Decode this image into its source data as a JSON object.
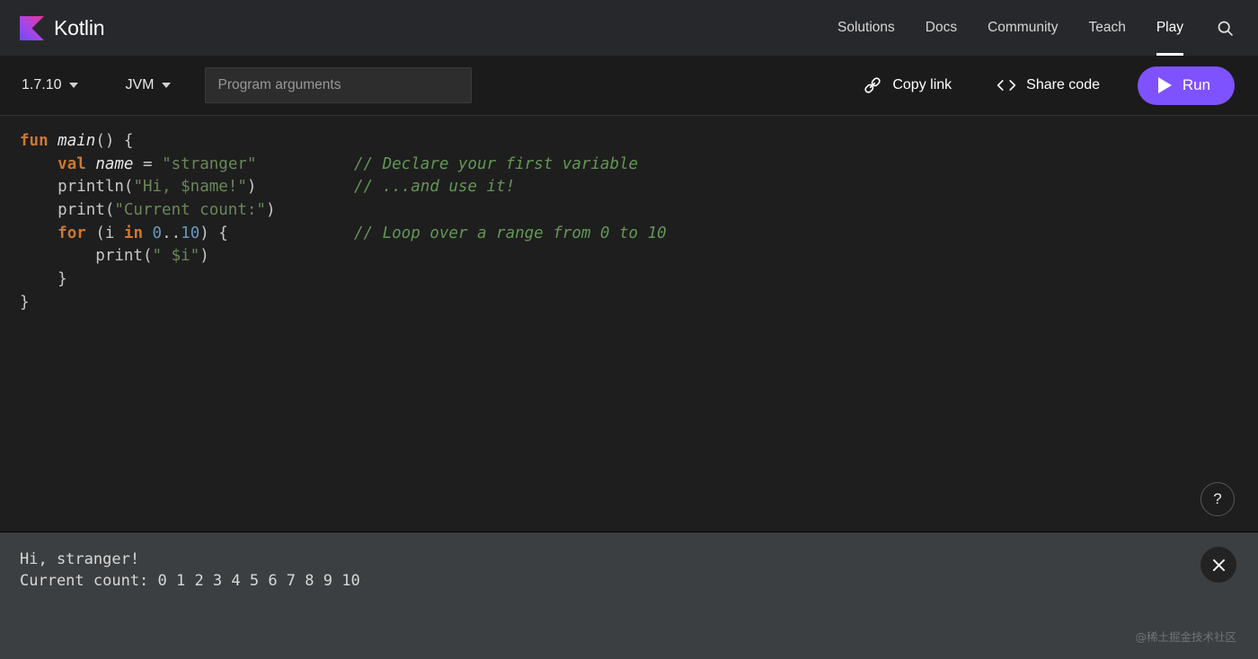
{
  "header": {
    "brand": {
      "name": "Kotlin",
      "logo_icon": "kotlin-logo-icon"
    },
    "nav": [
      {
        "label": "Solutions",
        "active": false
      },
      {
        "label": "Docs",
        "active": false
      },
      {
        "label": "Community",
        "active": false
      },
      {
        "label": "Teach",
        "active": false
      },
      {
        "label": "Play",
        "active": true
      }
    ],
    "search_icon": "search-icon"
  },
  "toolbar": {
    "version": "1.7.10",
    "platform": "JVM",
    "args_placeholder": "Program arguments",
    "args_value": "",
    "copy_link_label": "Copy link",
    "copy_link_icon": "link-icon",
    "share_code_label": "Share code",
    "share_code_icon": "code-brackets-icon",
    "run_label": "Run",
    "run_icon": "play-icon",
    "run_color": "#7f52ff"
  },
  "editor": {
    "language": "kotlin",
    "lines": [
      {
        "tokens": [
          {
            "t": "fun ",
            "c": "kw"
          },
          {
            "t": "main",
            "c": "fnname"
          },
          {
            "t": "() {",
            "c": "plain"
          }
        ],
        "comment": ""
      },
      {
        "tokens": [
          {
            "t": "    ",
            "c": "plain"
          },
          {
            "t": "val ",
            "c": "kw"
          },
          {
            "t": "name",
            "c": "ident-it"
          },
          {
            "t": " = ",
            "c": "plain"
          },
          {
            "t": "\"stranger\"",
            "c": "str"
          }
        ],
        "comment": "// Declare your first variable"
      },
      {
        "tokens": [
          {
            "t": "    println(",
            "c": "plain"
          },
          {
            "t": "\"Hi, $name!\"",
            "c": "str"
          },
          {
            "t": ")",
            "c": "plain"
          }
        ],
        "comment": "// ...and use it!"
      },
      {
        "tokens": [
          {
            "t": "    print(",
            "c": "plain"
          },
          {
            "t": "\"Current count:\"",
            "c": "str"
          },
          {
            "t": ")",
            "c": "plain"
          }
        ],
        "comment": ""
      },
      {
        "tokens": [
          {
            "t": "    ",
            "c": "plain"
          },
          {
            "t": "for ",
            "c": "kw"
          },
          {
            "t": "(i ",
            "c": "plain"
          },
          {
            "t": "in ",
            "c": "kw"
          },
          {
            "t": "0",
            "c": "num"
          },
          {
            "t": "..",
            "c": "plain"
          },
          {
            "t": "10",
            "c": "num"
          },
          {
            "t": ") {",
            "c": "plain"
          }
        ],
        "comment": "// Loop over a range from 0 to 10"
      },
      {
        "tokens": [
          {
            "t": "        print(",
            "c": "plain"
          },
          {
            "t": "\" $i\"",
            "c": "str"
          },
          {
            "t": ")",
            "c": "plain"
          }
        ],
        "comment": ""
      },
      {
        "tokens": [
          {
            "t": "    }",
            "c": "plain"
          }
        ],
        "comment": ""
      },
      {
        "tokens": [
          {
            "t": "}",
            "c": "plain"
          }
        ],
        "comment": ""
      }
    ],
    "help_label": "?",
    "colors": {
      "keyword": "#cc7832",
      "string": "#6a8759",
      "number": "#6897bb",
      "comment": "#629755",
      "text": "#c8c8c8",
      "background": "#1e1e1e"
    }
  },
  "output": {
    "lines": [
      "Hi, stranger!",
      "Current count: 0 1 2 3 4 5 6 7 8 9 10"
    ],
    "close_icon": "close-icon",
    "watermark": "@稀土掘金技术社区",
    "background": "#3c3f41"
  }
}
